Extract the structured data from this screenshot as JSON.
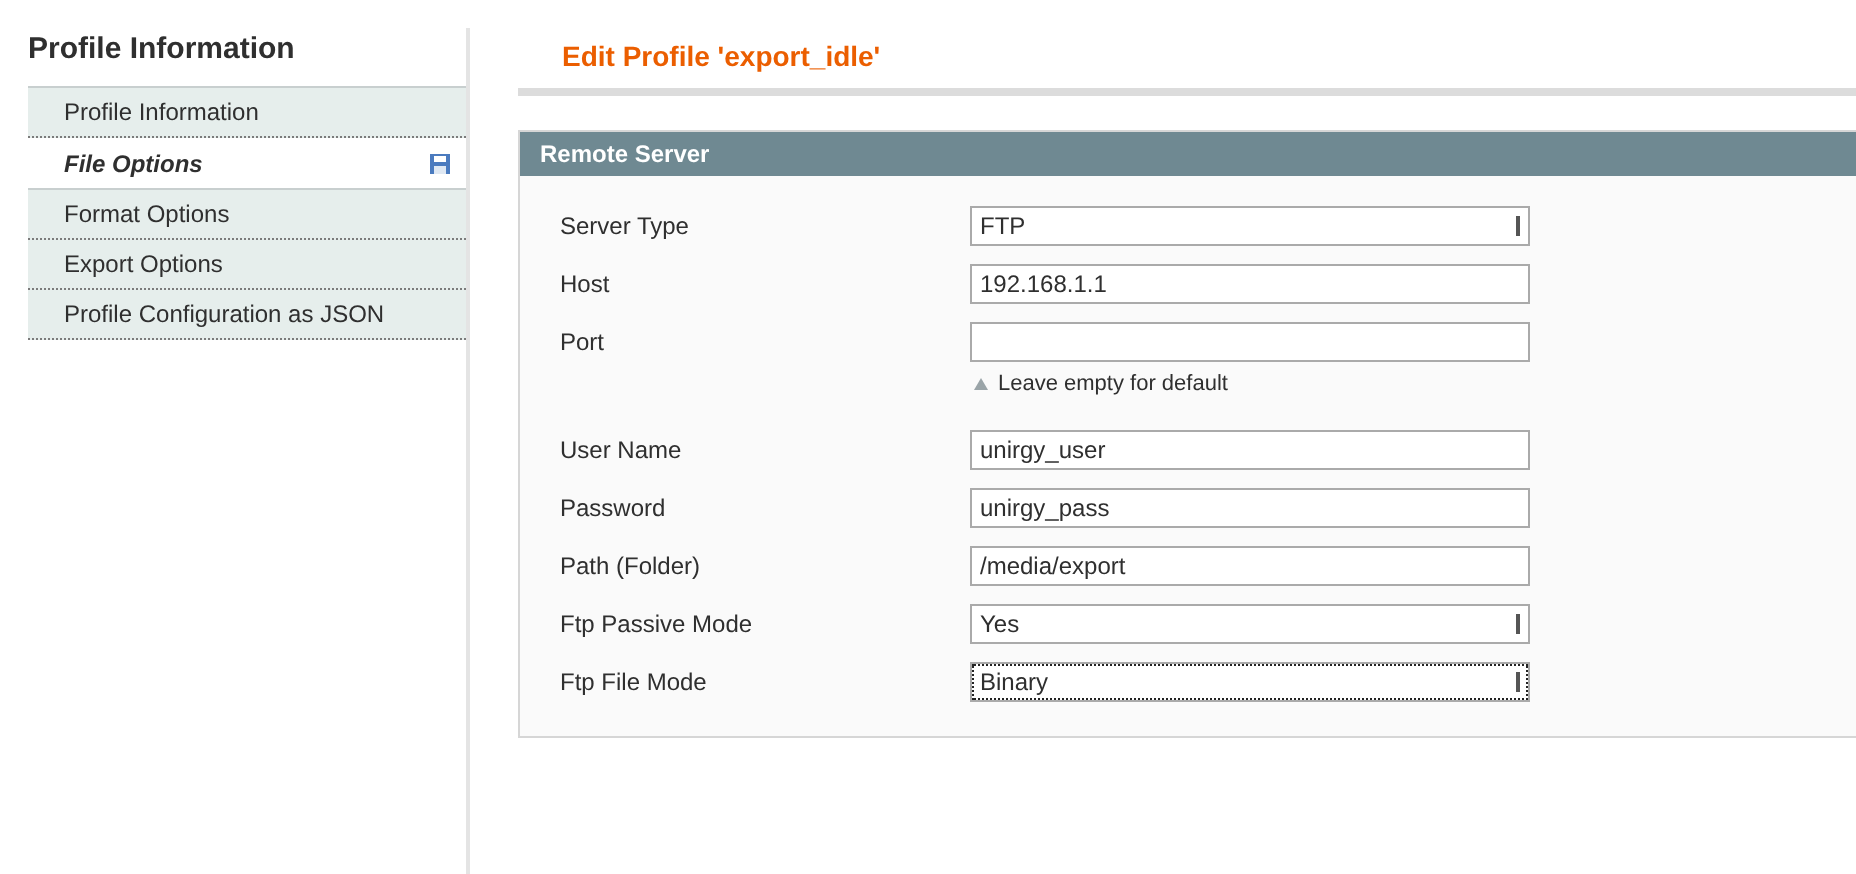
{
  "sidebar": {
    "title": "Profile Information",
    "items": [
      {
        "label": "Profile Information",
        "selected": false
      },
      {
        "label": "File Options",
        "selected": true
      },
      {
        "label": "Format Options",
        "selected": false
      },
      {
        "label": "Export Options",
        "selected": false
      },
      {
        "label": "Profile Configuration as JSON",
        "selected": false
      }
    ]
  },
  "page_title": "Edit Profile 'export_idle'",
  "section": {
    "title": "Remote Server",
    "fields": [
      {
        "label": "Server Type",
        "kind": "select",
        "value": "FTP",
        "focused": false
      },
      {
        "label": "Host",
        "kind": "text",
        "value": "192.168.1.1",
        "focused": false
      },
      {
        "label": "Port",
        "kind": "text",
        "focused": false,
        "hint": "Leave empty for default"
      },
      {
        "label": "User Name",
        "kind": "text",
        "value": "unirgy_user",
        "focused": false
      },
      {
        "label": "Password",
        "kind": "text",
        "value": "unirgy_pass",
        "focused": false
      },
      {
        "label": "Path (Folder)",
        "kind": "text",
        "value": "/media/export",
        "focused": false
      },
      {
        "label": "Ftp Passive Mode",
        "kind": "select",
        "value": "Yes",
        "focused": false
      },
      {
        "label": "Ftp File Mode",
        "kind": "select",
        "value": "Binary",
        "focused": true
      }
    ]
  }
}
